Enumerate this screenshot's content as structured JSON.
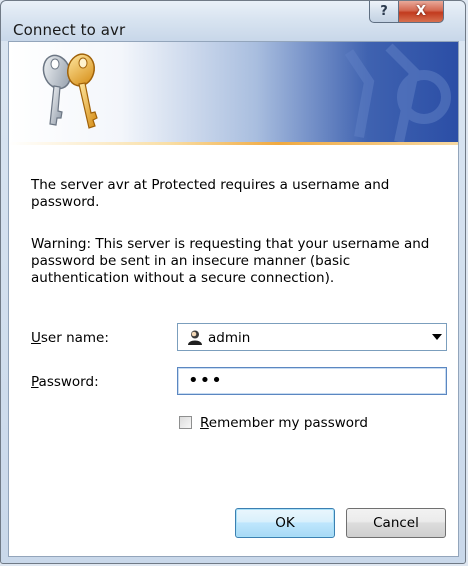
{
  "window": {
    "title": "Connect to avr",
    "help_glyph": "?",
    "close_glyph": "X"
  },
  "message": {
    "line1": "The server avr at Protected requires a username and password.",
    "warning": "Warning: This server is requesting that your username and password be sent in an insecure manner (basic authentication without a secure connection)."
  },
  "form": {
    "username_label_accel": "U",
    "username_label_rest": "ser name:",
    "username_value": "admin",
    "password_label_accel": "P",
    "password_label_rest": "assword:",
    "password_value": "•••",
    "remember_accel": "R",
    "remember_rest": "emember my password",
    "remember_checked": false
  },
  "buttons": {
    "ok": "OK",
    "cancel": "Cancel"
  },
  "icons": {
    "keys": "keys-icon",
    "user": "user-account-icon",
    "dropdown": "chevron-down-icon",
    "help": "help-icon",
    "close": "close-icon"
  },
  "colors": {
    "banner_dark": "#2b4ea6",
    "banner_rule": "#f0a940",
    "close_red": "#c23a1e",
    "ok_border": "#3c7fb1"
  }
}
